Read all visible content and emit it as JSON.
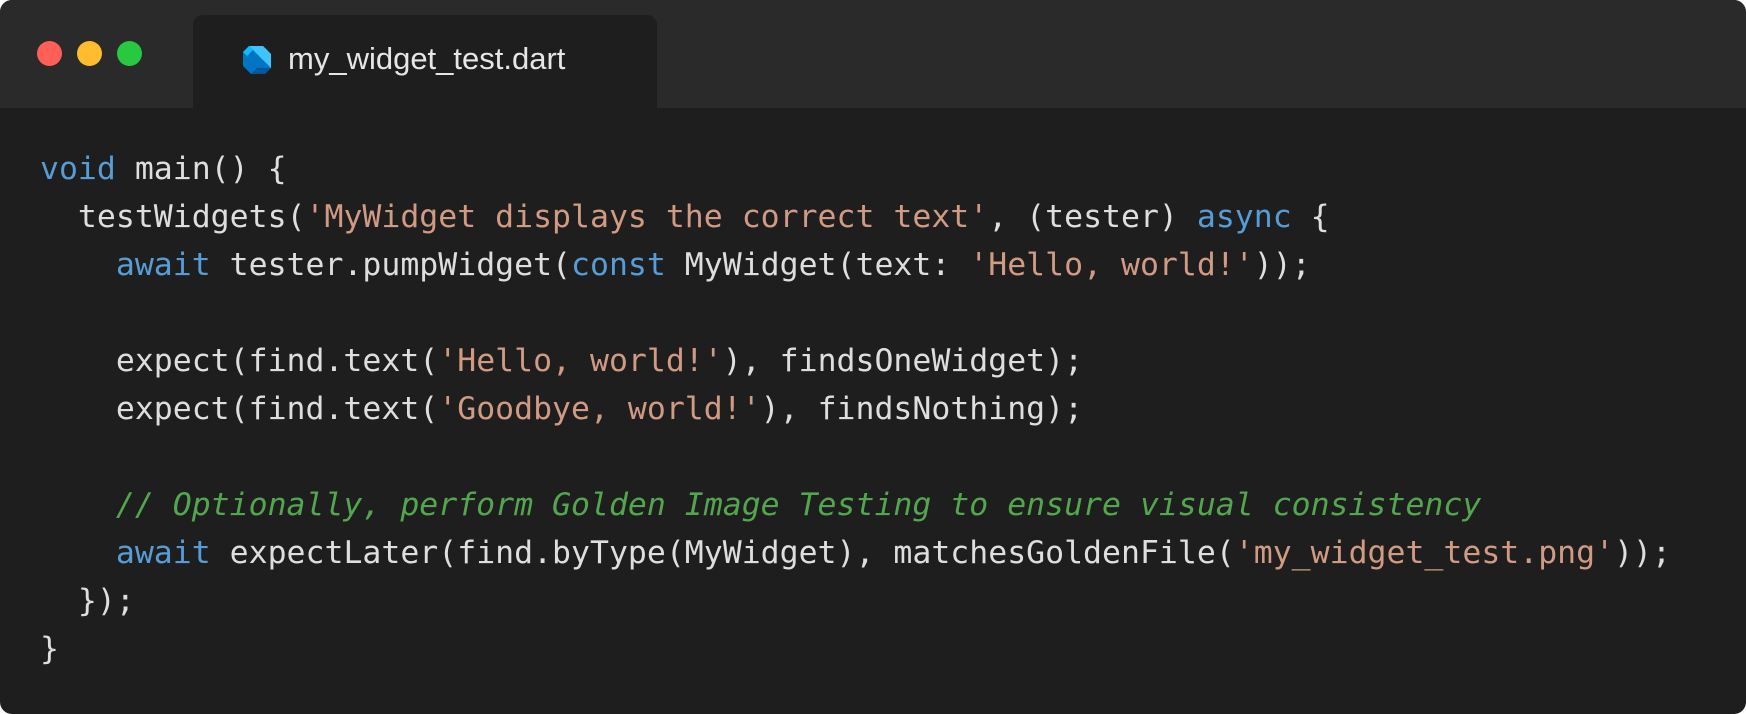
{
  "window": {
    "tab": {
      "title": "my_widget_test.dart",
      "icon": "dart-icon"
    },
    "traffic_lights": [
      {
        "name": "close-window-button",
        "color": "#ff5f57"
      },
      {
        "name": "minimize-window-button",
        "color": "#febc2e"
      },
      {
        "name": "zoom-window-button",
        "color": "#28c840"
      }
    ]
  },
  "colors": {
    "background": "#1e1e1e",
    "titlebar": "#2a2a2a",
    "keyword": "#569cd6",
    "string": "#d19a82",
    "comment": "#52a74e",
    "plain": "#dedede"
  },
  "code": {
    "language": "dart",
    "lines": [
      [
        [
          "keyword",
          "void"
        ],
        [
          "plain",
          " main() {"
        ]
      ],
      [
        [
          "plain",
          "  testWidgets("
        ],
        [
          "string",
          "'MyWidget displays the correct text'"
        ],
        [
          "plain",
          ", (tester) "
        ],
        [
          "keyword",
          "async"
        ],
        [
          "plain",
          " {"
        ]
      ],
      [
        [
          "plain",
          "    "
        ],
        [
          "keyword",
          "await"
        ],
        [
          "plain",
          " tester.pumpWidget("
        ],
        [
          "keyword",
          "const"
        ],
        [
          "plain",
          " MyWidget(text: "
        ],
        [
          "string",
          "'Hello, world!'"
        ],
        [
          "plain",
          "));"
        ]
      ],
      [],
      [
        [
          "plain",
          "    expect(find.text("
        ],
        [
          "string",
          "'Hello, world!'"
        ],
        [
          "plain",
          "), findsOneWidget);"
        ]
      ],
      [
        [
          "plain",
          "    expect(find.text("
        ],
        [
          "string",
          "'Goodbye, world!'"
        ],
        [
          "plain",
          "), findsNothing);"
        ]
      ],
      [],
      [
        [
          "plain",
          "    "
        ],
        [
          "comment",
          "// Optionally, perform Golden Image Testing to ensure visual consistency"
        ]
      ],
      [
        [
          "plain",
          "    "
        ],
        [
          "keyword",
          "await"
        ],
        [
          "plain",
          " expectLater(find.byType(MyWidget), matchesGoldenFile("
        ],
        [
          "string",
          "'my_widget_test.png'"
        ],
        [
          "plain",
          "));"
        ]
      ],
      [
        [
          "plain",
          "  });"
        ]
      ],
      [
        [
          "plain",
          "}"
        ]
      ]
    ]
  }
}
